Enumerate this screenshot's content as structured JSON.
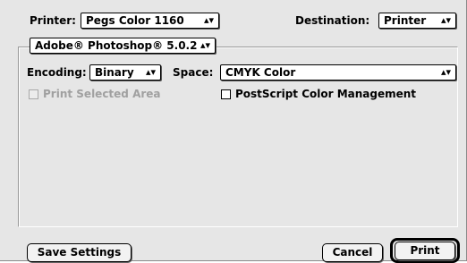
{
  "header": {
    "printer_label": "Printer:",
    "printer_value": "Pegs Color 1160",
    "destination_label": "Destination:",
    "destination_value": "Printer"
  },
  "panel": {
    "selected": "Adobe® Photoshop® 5.0.2"
  },
  "options": {
    "encoding_label": "Encoding:",
    "encoding_value": "Binary",
    "space_label": "Space:",
    "space_value": "CMYK Color",
    "print_selected_area": "Print Selected Area",
    "print_selected_area_enabled": false,
    "postscript_color_management": "PostScript Color Management",
    "postscript_color_management_checked": false
  },
  "footer": {
    "save_settings": "Save Settings",
    "cancel": "Cancel",
    "print": "Print"
  },
  "icons": {
    "popup_arrows": "⬍"
  }
}
